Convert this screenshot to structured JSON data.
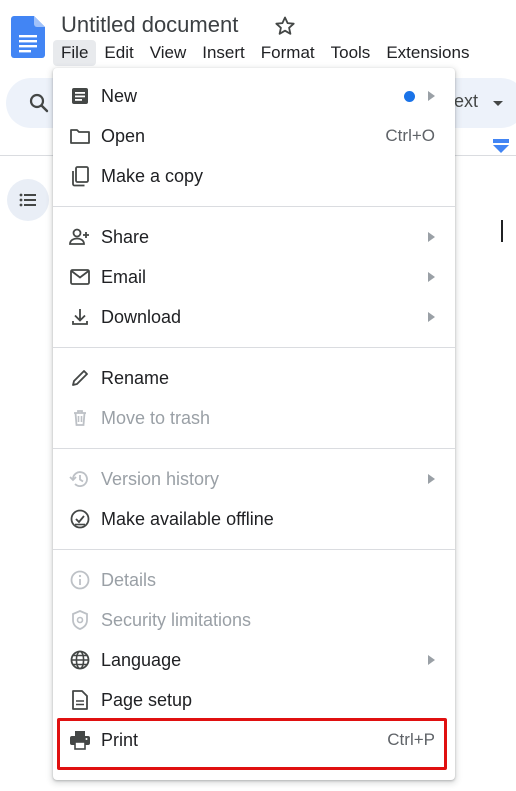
{
  "header": {
    "doc_title": "Untitled document",
    "menus": [
      "File",
      "Edit",
      "View",
      "Insert",
      "Format",
      "Tools",
      "Extensions"
    ]
  },
  "toolbar": {
    "partial_text": "ext"
  },
  "file_menu": {
    "groups": [
      [
        {
          "label": "New",
          "icon": "doc-icon",
          "submenu": true,
          "dot": true
        },
        {
          "label": "Open",
          "icon": "folder-icon",
          "shortcut": "Ctrl+O"
        },
        {
          "label": "Make a copy",
          "icon": "copy-icon"
        }
      ],
      [
        {
          "label": "Share",
          "icon": "person-add-icon",
          "submenu": true
        },
        {
          "label": "Email",
          "icon": "mail-icon",
          "submenu": true
        },
        {
          "label": "Download",
          "icon": "download-icon",
          "submenu": true
        }
      ],
      [
        {
          "label": "Rename",
          "icon": "pencil-icon"
        },
        {
          "label": "Move to trash",
          "icon": "trash-icon",
          "disabled": true
        }
      ],
      [
        {
          "label": "Version history",
          "icon": "history-icon",
          "submenu": true,
          "disabled": true
        },
        {
          "label": "Make available offline",
          "icon": "offline-check-icon"
        }
      ],
      [
        {
          "label": "Details",
          "icon": "info-icon",
          "disabled": true
        },
        {
          "label": "Security limitations",
          "icon": "shield-icon",
          "disabled": true
        },
        {
          "label": "Language",
          "icon": "globe-icon",
          "submenu": true
        },
        {
          "label": "Page setup",
          "icon": "page-setup-icon"
        },
        {
          "label": "Print",
          "icon": "printer-icon",
          "shortcut": "Ctrl+P",
          "highlighted": true
        }
      ]
    ]
  },
  "colors": {
    "accent_dot": "#1a73e8",
    "highlight_box": "#e01010",
    "disabled_text": "#9aa0a6"
  }
}
